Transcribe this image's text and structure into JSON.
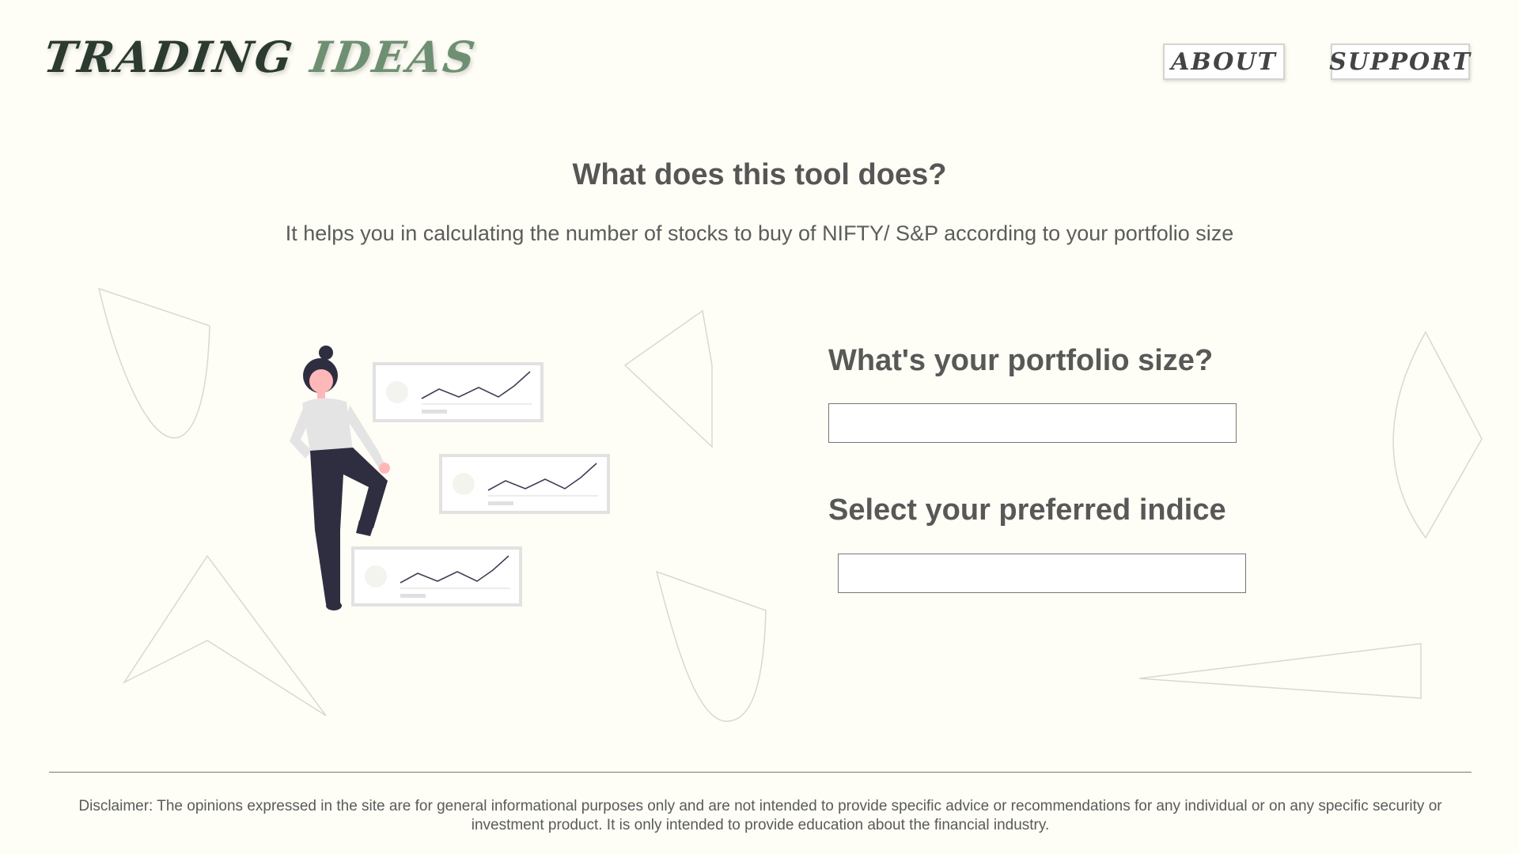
{
  "header": {
    "logo_word1": "TRADING",
    "logo_word2": "IDEAS",
    "nav": [
      {
        "label": "ABOUT"
      },
      {
        "label": "SUPPORT"
      }
    ]
  },
  "hero": {
    "title": "What does this tool does?",
    "subtitle": "It helps you in calculating the number of stocks to buy of NIFTY/ S&P according to your portfolio size"
  },
  "form": {
    "portfolio_label": "What's your portfolio size?",
    "portfolio_value": "",
    "indice_label": "Select your preferred indice",
    "indice_value": ""
  },
  "footer": {
    "disclaimer": "Disclaimer: The opinions expressed in the site are for general informational purposes only and are not intended to provide specific advice or recommendations for any individual or on any specific security or investment product.  It is only intended to provide education about the financial industry."
  },
  "colors": {
    "background": "#fefef6",
    "logo_dark": "#2c3a30",
    "logo_green": "#6f8f72",
    "text": "#565656",
    "figure_dark": "#2f2e41",
    "skin": "#ffb8b8"
  }
}
